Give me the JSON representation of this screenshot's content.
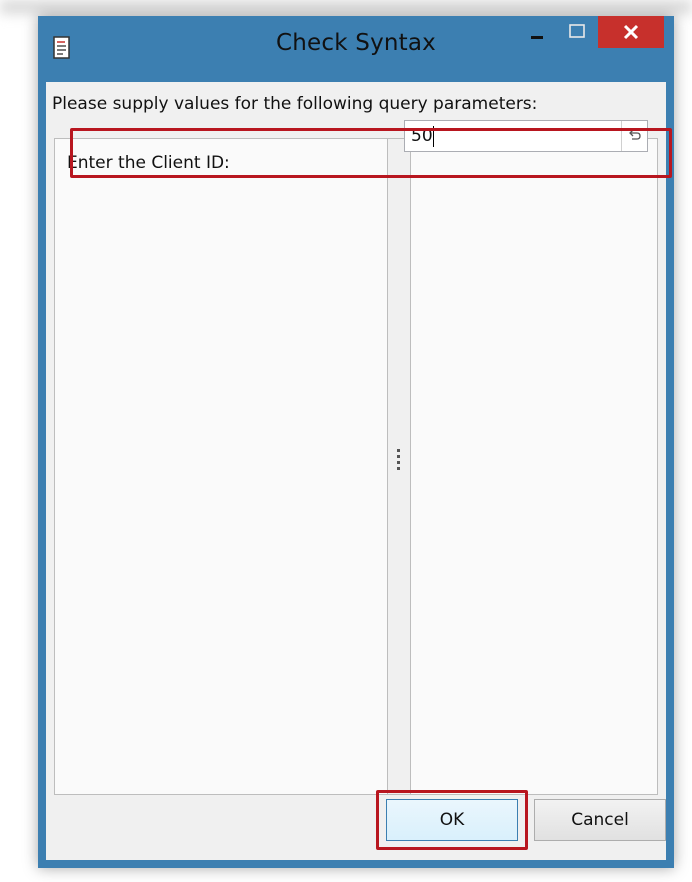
{
  "window": {
    "title": "Check Syntax"
  },
  "dialog": {
    "prompt": "Please supply values for the following query parameters:",
    "parameters": [
      {
        "label": "Enter the Client ID:",
        "value": "50"
      }
    ]
  },
  "buttons": {
    "ok": "OK",
    "cancel": "Cancel"
  },
  "colors": {
    "frame": "#3c7fb1",
    "close_button": "#c7302c",
    "highlight": "#b8161f"
  },
  "icons": {
    "title": "document-icon",
    "minimize": "minimize-icon",
    "maximize": "maximize-icon",
    "close": "close-icon",
    "reset": "undo-arrow-icon",
    "splitter": "grip-dots-icon"
  }
}
